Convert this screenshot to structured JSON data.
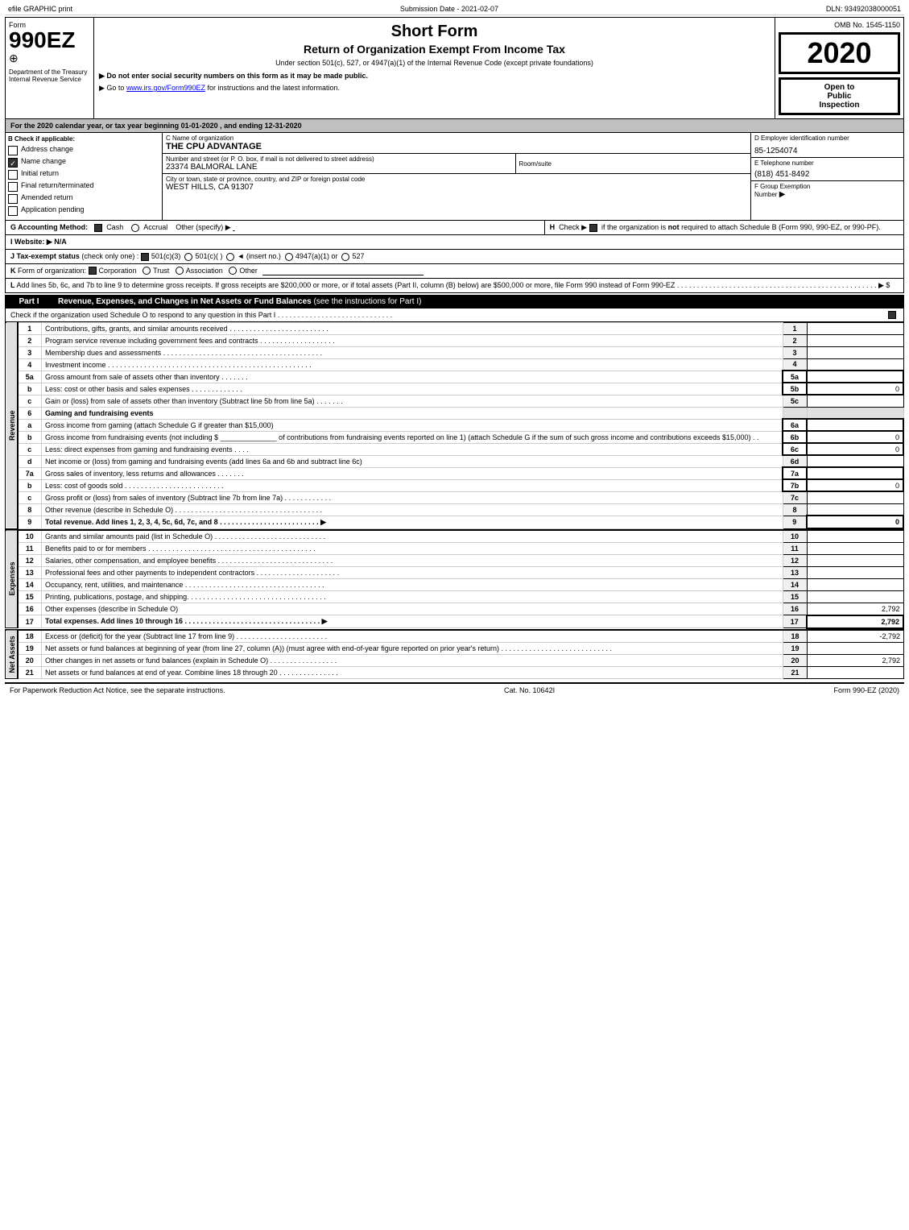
{
  "topBar": {
    "left": "efile GRAPHIC print",
    "center": "Submission Date - 2021-02-07",
    "right": "DLN: 93492038000051"
  },
  "formHeader": {
    "formNumber": "Form",
    "form990ez": "990EZ",
    "icon": "⊕",
    "title": "Short Form",
    "subtitle": "Return of Organization Exempt From Income Tax",
    "note1": "Under section 501(c), 527, or 4947(a)(1) of the Internal Revenue Code (except private foundations)",
    "note2": "▶ Do not enter social security numbers on this form as it may be made public.",
    "note3": "▶ Go to www.irs.gov/Form990EZ for instructions and the latest information.",
    "ombLabel": "OMB No. 1545-1150",
    "year": "2020",
    "openToPublic": "Open to\nPublic\nInspection"
  },
  "deptSection": {
    "dept": "Department of the Treasury",
    "irs": "Internal Revenue Service"
  },
  "yearSection": {
    "text": "For the 2020 calendar year, or tax year beginning 01-01-2020 , and ending 12-31-2020"
  },
  "checkSection": {
    "label": "B Check if applicable:",
    "checks": [
      {
        "id": "address",
        "label": "Address change",
        "checked": false
      },
      {
        "id": "name",
        "label": "Name change",
        "checked": true
      },
      {
        "id": "initial",
        "label": "Initial return",
        "checked": false
      },
      {
        "id": "final",
        "label": "Final return/terminated",
        "checked": false
      },
      {
        "id": "amended",
        "label": "Amended return",
        "checked": false
      },
      {
        "id": "pending",
        "label": "Application pending",
        "checked": false
      }
    ],
    "cLabel": "C Name of organization",
    "orgName": "THE CPU ADVANTAGE",
    "numberLabel": "Number and street (or P. O. box, if mail is not delivered to street address)",
    "streetAddress": "23374 BALMORAL LANE",
    "roomSuiteLabel": "Room/suite",
    "cityLabel": "City or town, state or province, country, and ZIP or foreign postal code",
    "cityValue": "WEST HILLS, CA  91307",
    "dLabel": "D Employer identification number",
    "ein": "85-1254074",
    "eLabel": "E Telephone number",
    "phone": "(818) 451-8492",
    "fLabel": "F Group Exemption\nNumber",
    "fArrow": "▶"
  },
  "accountingSection": {
    "gLabel": "G Accounting Method:",
    "cashLabel": "Cash",
    "cashChecked": true,
    "accrualLabel": "Accrual",
    "accrualChecked": false,
    "otherLabel": "Other (specify) ▶",
    "hLabel": "H Check ▶",
    "hChecked": true,
    "hText": "if the organization is not required to attach Schedule B (Form 990, 990-EZ, or 990-PF)."
  },
  "websiteSection": {
    "iLabel": "I Website: ▶",
    "iValue": "N/A"
  },
  "taxExemptSection": {
    "jLabel": "J Tax-exempt status (check only one):",
    "options": [
      {
        "label": "501(c)(3)",
        "checked": true
      },
      {
        "label": "501(c)(  )",
        "checked": false
      },
      {
        "label": "(insert no.)",
        "checked": false
      },
      {
        "label": "4947(a)(1) or",
        "checked": false
      },
      {
        "label": "527",
        "checked": false
      }
    ]
  },
  "formOrgSection": {
    "kLabel": "K Form of organization:",
    "options": [
      {
        "label": "Corporation",
        "checked": true
      },
      {
        "label": "Trust",
        "checked": false
      },
      {
        "label": "Association",
        "checked": false
      },
      {
        "label": "Other",
        "checked": false
      }
    ]
  },
  "lineLSection": {
    "text": "L Add lines 5b, 6c, and 7b to line 9 to determine gross receipts. If gross receipts are $200,000 or more, or if total assets (Part II, column (B) below) are $500,000 or more, file Form 990 instead of Form 990-EZ . . . . . . . . . . . . . . . . . . . . . . . . . . . . . . . . . ▶ $"
  },
  "partI": {
    "label": "Part I",
    "title": "Revenue, Expenses, and Changes in Net Assets or Fund Balances",
    "seeNote": "(see the instructions for Part I)",
    "checkNote": "Check if the organization used Schedule O to respond to any question in this Part I . . . . . . . . . . . . . . . . . . . .",
    "checkOUsed": true,
    "lines": [
      {
        "num": "1",
        "desc": "Contributions, gifts, grants, and similar amounts received . . . . . . . . . . . . . . . . . . . . . . . . . .",
        "lineNum": "1",
        "value": ""
      },
      {
        "num": "2",
        "desc": "Program service revenue including government fees and contracts . . . . . . . . . . . . . . . . . . .",
        "lineNum": "2",
        "value": ""
      },
      {
        "num": "3",
        "desc": "Membership dues and assessments . . . . . . . . . . . . . . . . . . . . . . . . . . . . . . . . . . . . . . . .",
        "lineNum": "3",
        "value": ""
      },
      {
        "num": "4",
        "desc": "Investment income . . . . . . . . . . . . . . . . . . . . . . . . . . . . . . . . . . . . . . . . . . . . . . . . . . .",
        "lineNum": "4",
        "value": ""
      },
      {
        "num": "5a",
        "desc": "Gross amount from sale of assets other than inventory . . . . . . .",
        "ref": "5a",
        "value": ""
      },
      {
        "num": "b",
        "desc": "Less: cost or other basis and sales expenses . . . . . . . . . . . . .",
        "ref": "5b",
        "value": "0"
      },
      {
        "num": "c",
        "desc": "Gain or (loss) from sale of assets other than inventory (Subtract line 5b from line 5a) . . . . . . .",
        "lineNum": "5c",
        "value": ""
      },
      {
        "num": "6",
        "desc": "Gaming and fundraising events",
        "isHeader": true
      },
      {
        "num": "a",
        "desc": "Gross income from gaming (attach Schedule G if greater than $15,000)",
        "ref": "6a",
        "value": ""
      },
      {
        "num": "b",
        "desc": "Gross income from fundraising events (not including $ ______________ of contributions from fundraising events reported on line 1) (attach Schedule G if the sum of such gross income and contributions exceeds $15,000) . .",
        "ref": "6b",
        "value": "0"
      },
      {
        "num": "c",
        "desc": "Less: direct expenses from gaming and fundraising events . . . .",
        "ref": "6c",
        "value": "0"
      },
      {
        "num": "d",
        "desc": "Net income or (loss) from gaming and fundraising events (add lines 6a and 6b and subtract line 6c)",
        "lineNum": "6d",
        "value": ""
      },
      {
        "num": "7a",
        "desc": "Gross sales of inventory, less returns and allowances . . . . . . .",
        "ref": "7a",
        "value": ""
      },
      {
        "num": "b",
        "desc": "Less: cost of goods sold . . . . . . . . . . . . . . . . . . . . . . . . .",
        "ref": "7b",
        "value": "0"
      },
      {
        "num": "c",
        "desc": "Gross profit or (loss) from sales of inventory (Subtract line 7b from line 7a) . . . . . . . . . . .",
        "lineNum": "7c",
        "value": ""
      },
      {
        "num": "8",
        "desc": "Other revenue (describe in Schedule O) . . . . . . . . . . . . . . . . . . . . . . . . . . . . . . . . . . . . .",
        "lineNum": "8",
        "value": ""
      },
      {
        "num": "9",
        "desc": "Total revenue. Add lines 1, 2, 3, 4, 5c, 6d, 7c, and 8 . . . . . . . . . . . . . . . . . . . . . . . . . ▶",
        "lineNum": "9",
        "value": "0",
        "bold": true
      }
    ]
  },
  "partIExpenses": {
    "sectionLabel": "Expenses",
    "lines": [
      {
        "num": "10",
        "desc": "Grants and similar amounts paid (list in Schedule O) . . . . . . . . . . . . . . . . . . . . . . . . . . . .",
        "lineNum": "10",
        "value": ""
      },
      {
        "num": "11",
        "desc": "Benefits paid to or for members . . . . . . . . . . . . . . . . . . . . . . . . . . . . . . . . . . . . . . . . . .",
        "lineNum": "11",
        "value": ""
      },
      {
        "num": "12",
        "desc": "Salaries, other compensation, and employee benefits . . . . . . . . . . . . . . . . . . . . . . . . . . . . .",
        "lineNum": "12",
        "value": ""
      },
      {
        "num": "13",
        "desc": "Professional fees and other payments to independent contractors . . . . . . . . . . . . . . . . . . . . .",
        "lineNum": "13",
        "value": ""
      },
      {
        "num": "14",
        "desc": "Occupancy, rent, utilities, and maintenance . . . . . . . . . . . . . . . . . . . . . . . . . . . . . . . . . . .",
        "lineNum": "14",
        "value": ""
      },
      {
        "num": "15",
        "desc": "Printing, publications, postage, and shipping. . . . . . . . . . . . . . . . . . . . . . . . . . . . . . . . . . .",
        "lineNum": "15",
        "value": ""
      },
      {
        "num": "16",
        "desc": "Other expenses (describe in Schedule O)",
        "lineNum": "16",
        "value": "2,792"
      },
      {
        "num": "17",
        "desc": "Total expenses. Add lines 10 through 16 . . . . . . . . . . . . . . . . . . . . . . . . . . . . . . . . . . ▶",
        "lineNum": "17",
        "value": "2,792",
        "bold": true
      }
    ]
  },
  "partINetAssets": {
    "sectionLabel": "Net Assets",
    "lines": [
      {
        "num": "18",
        "desc": "Excess or (deficit) for the year (Subtract line 17 from line 9) . . . . . . . . . . . . . . . . . . . . . . .",
        "lineNum": "18",
        "value": "-2,792"
      },
      {
        "num": "19",
        "desc": "Net assets or fund balances at beginning of year (from line 27, column (A)) (must agree with end-of-year figure reported on prior year's return) . . . . . . . . . . . . . . . . . . . . . . . . . . . .",
        "lineNum": "19",
        "value": ""
      },
      {
        "num": "20",
        "desc": "Other changes in net assets or fund balances (explain in Schedule O) . . . . . . . . . . . . . . . . .",
        "lineNum": "20",
        "value": "2,792"
      },
      {
        "num": "21",
        "desc": "Net assets or fund balances at end of year. Combine lines 18 through 20 . . . . . . . . . . . . . . .",
        "lineNum": "21",
        "value": ""
      }
    ]
  },
  "footer": {
    "left": "For Paperwork Reduction Act Notice, see the separate instructions.",
    "center": "Cat. No. 10642I",
    "right": "Form 990-EZ (2020)"
  }
}
